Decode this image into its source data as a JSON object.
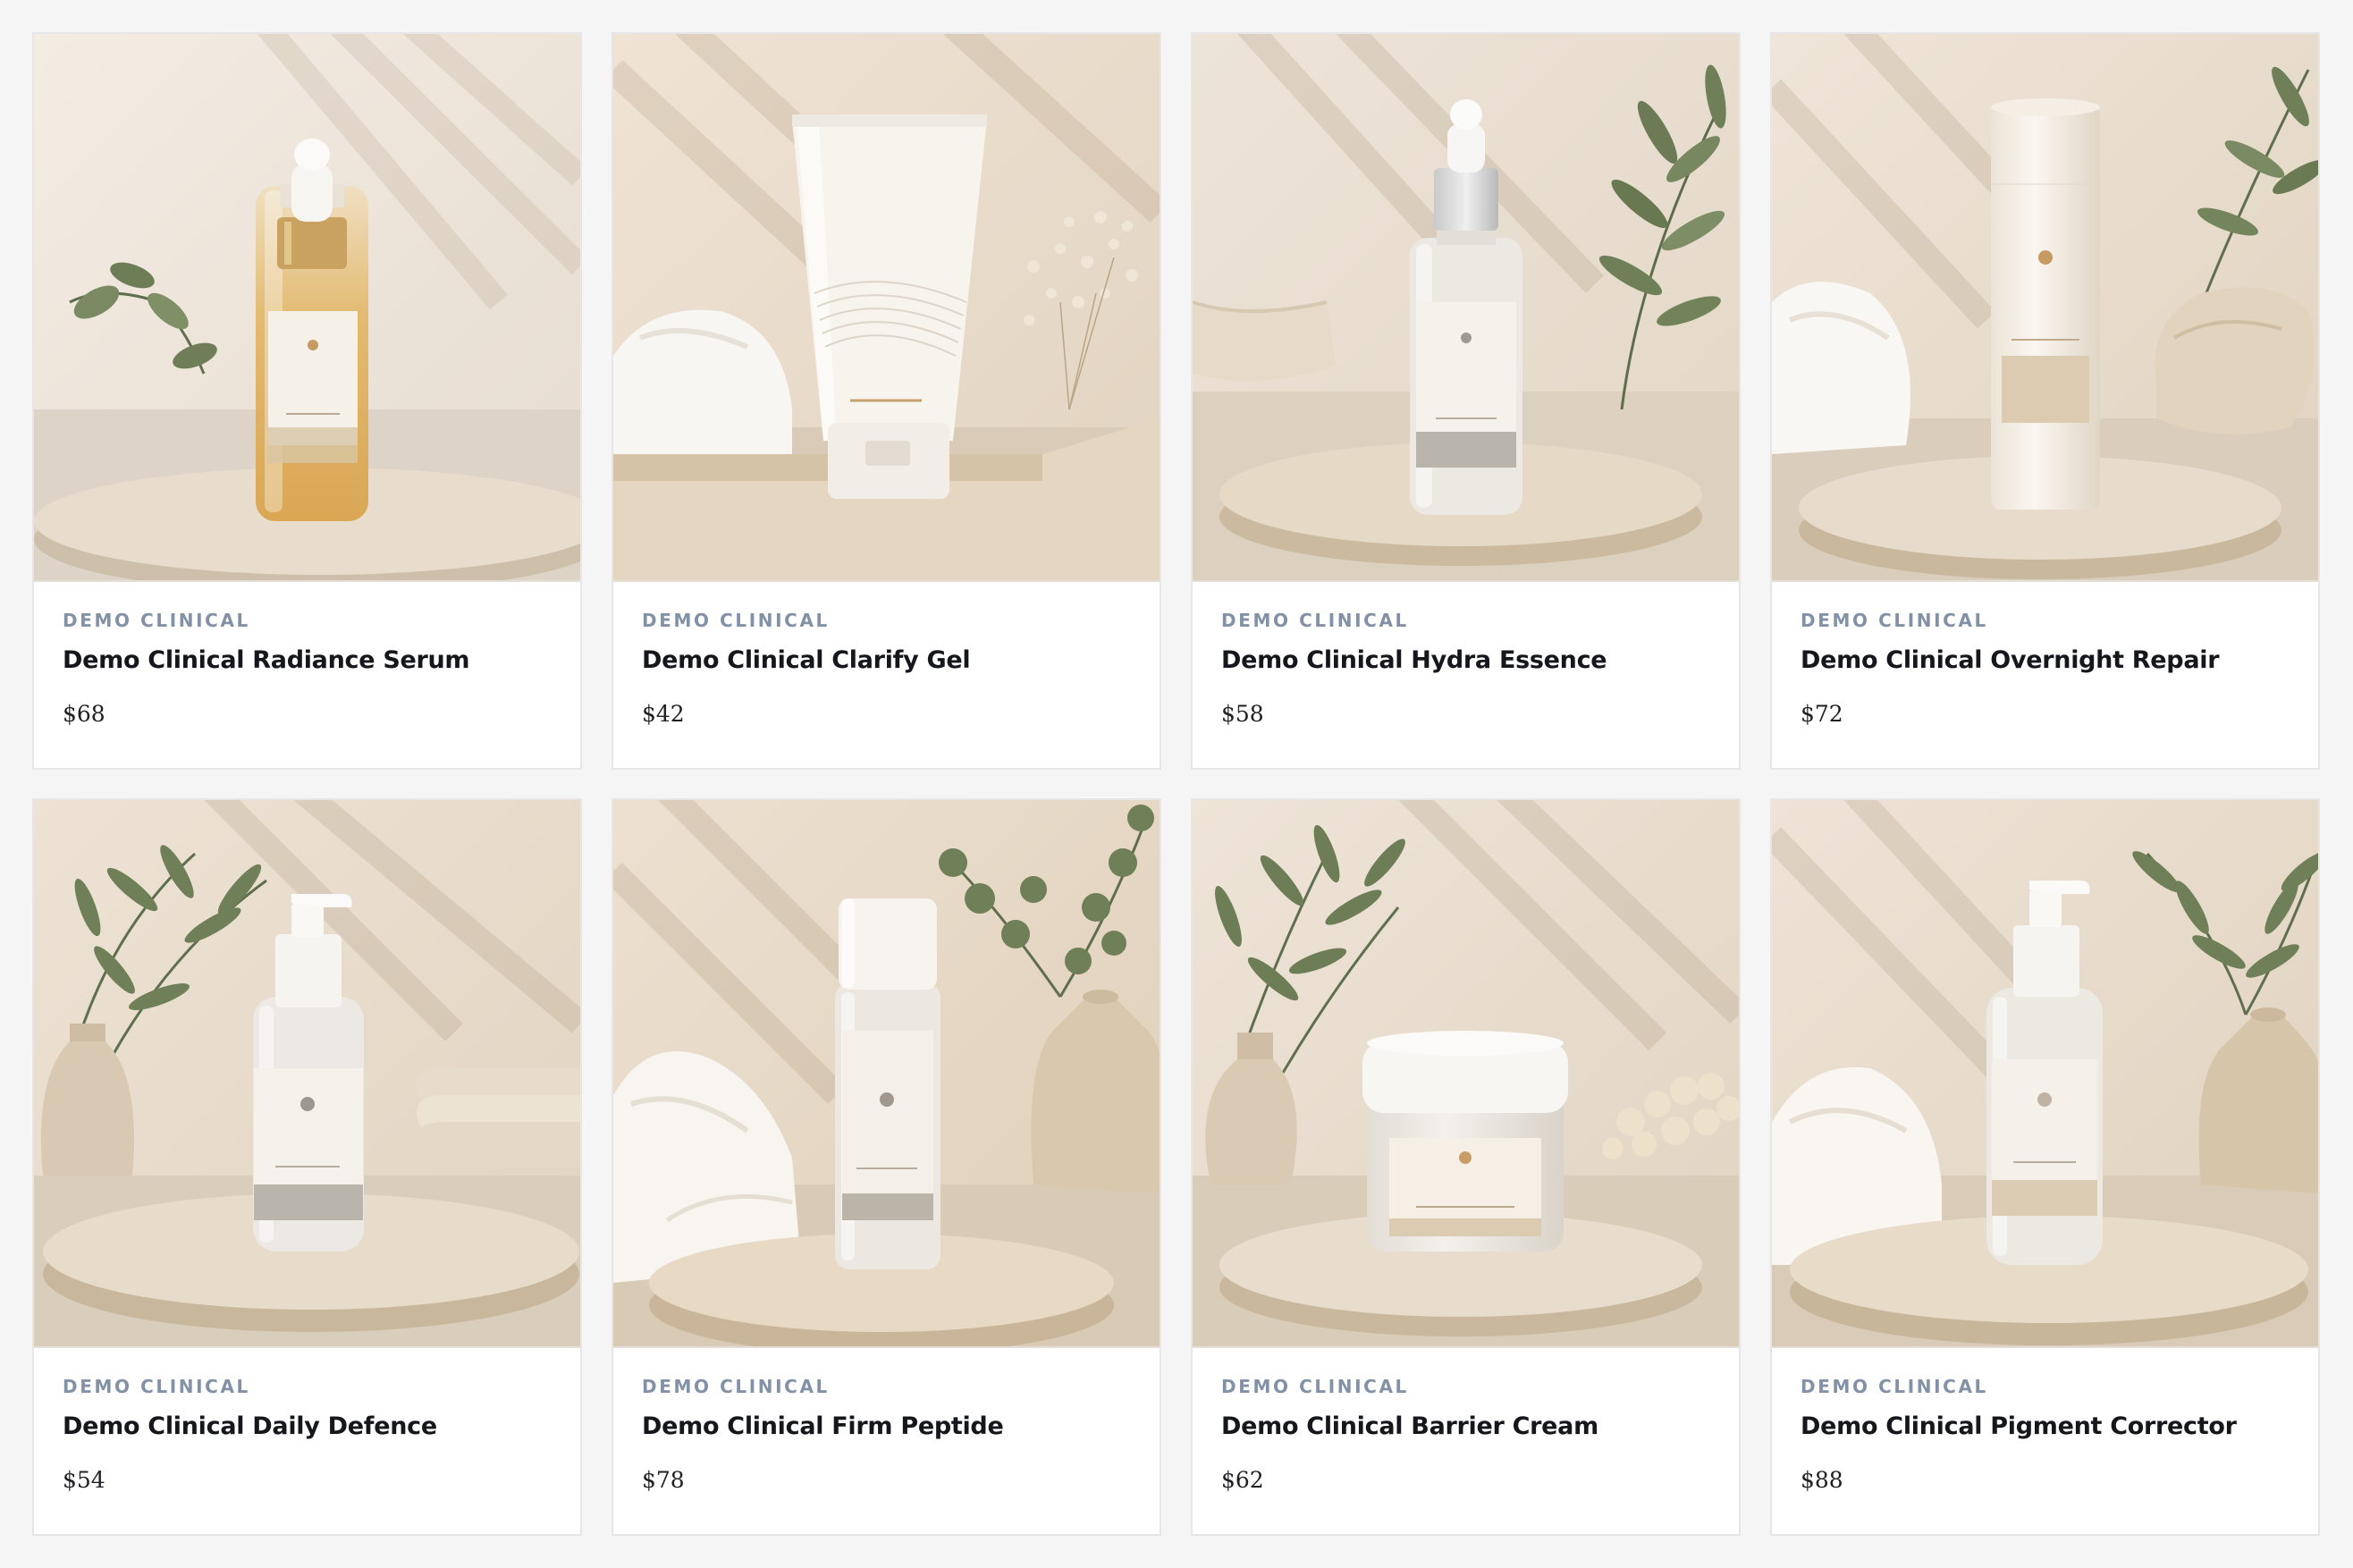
{
  "products": [
    {
      "brand": "DEMO CLINICAL",
      "name": "Demo Clinical Radiance Serum",
      "price": "$68",
      "image": "amber-dropper-serum-bottle"
    },
    {
      "brand": "DEMO CLINICAL",
      "name": "Demo Clinical Clarify Gel",
      "price": "$42",
      "image": "white-squeeze-tube"
    },
    {
      "brand": "DEMO CLINICAL",
      "name": "Demo Clinical Hydra Essence",
      "price": "$58",
      "image": "frosted-dropper-bottle"
    },
    {
      "brand": "DEMO CLINICAL",
      "name": "Demo Clinical Overnight Repair",
      "price": "$72",
      "image": "cream-cylinder-bottle"
    },
    {
      "brand": "DEMO CLINICAL",
      "name": "Demo Clinical Daily Defence",
      "price": "$54",
      "image": "frosted-pump-bottle"
    },
    {
      "brand": "DEMO CLINICAL",
      "name": "Demo Clinical Firm Peptide",
      "price": "$78",
      "image": "frosted-capped-bottle"
    },
    {
      "brand": "DEMO CLINICAL",
      "name": "Demo Clinical Barrier Cream",
      "price": "$62",
      "image": "frosted-cream-jar"
    },
    {
      "brand": "DEMO CLINICAL",
      "name": "Demo Clinical Pigment Corrector",
      "price": "$88",
      "image": "frosted-pump-bottle"
    }
  ],
  "colors": {
    "brand_text": "#8391a6",
    "name_text": "#15171c",
    "page_bg": "#f5f5f6",
    "card_bg": "#ffffff"
  }
}
